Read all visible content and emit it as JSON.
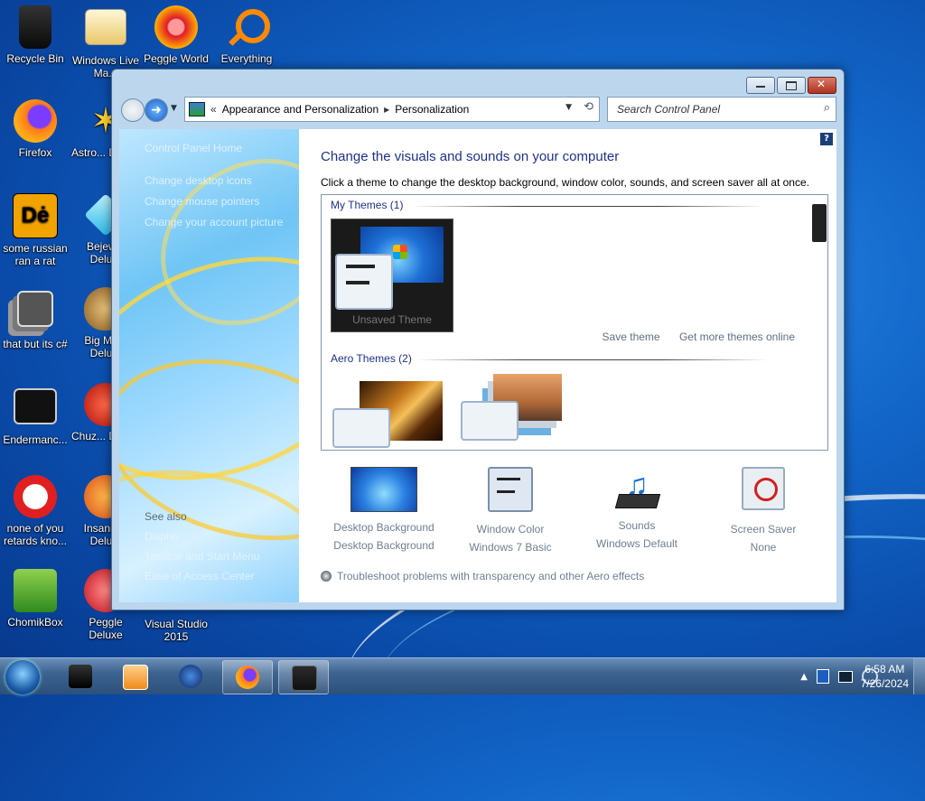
{
  "desktop": {
    "icons": [
      {
        "label": "Recycle Bin"
      },
      {
        "label": "Windows Live Ma..."
      },
      {
        "label": "Peggle World"
      },
      {
        "label": "Everything"
      },
      {
        "label": "Firefox"
      },
      {
        "label": "Astro... Delu..."
      },
      {
        "label": "some russian ran a rat"
      },
      {
        "label": "Bejew... Delu..."
      },
      {
        "label": "that but its c#"
      },
      {
        "label": "Big Mo... Delu..."
      },
      {
        "label": "Endermanc..."
      },
      {
        "label": "Chuz... Delu..."
      },
      {
        "label": "none of you retards kno..."
      },
      {
        "label": "Insaniq... Delu..."
      },
      {
        "label": "ChomikBox"
      },
      {
        "label": "Peggle Deluxe"
      },
      {
        "label": "Visual Studio 2015"
      }
    ]
  },
  "window": {
    "address": {
      "crumb_prefix": "«",
      "crumb1": "Appearance and Personalization",
      "crumb_sep": "▸",
      "crumb2": "Personalization"
    },
    "search": {
      "placeholder": "Search Control Panel"
    },
    "left_pane": {
      "home": "Control Panel Home",
      "links": [
        "Change desktop icons",
        "Change mouse pointers",
        "Change your account picture"
      ],
      "see_also": "See also",
      "see_also_links": [
        "Display",
        "Taskbar and Start Menu",
        "Ease of Access Center"
      ]
    },
    "content": {
      "title": "Change the visuals and sounds on your computer",
      "subtitle": "Click a theme to change the desktop background, window color, sounds, and screen saver all at once.",
      "my_themes_header": "My Themes (1)",
      "unsaved_theme_label": "Unsaved Theme",
      "save_theme": "Save theme",
      "get_more": "Get more themes online",
      "aero_header": "Aero Themes (2)",
      "bottom": [
        {
          "title": "Desktop Background",
          "value": "Desktop Background"
        },
        {
          "title": "Window Color",
          "value": "Windows 7 Basic"
        },
        {
          "title": "Sounds",
          "value": "Windows Default"
        },
        {
          "title": "Screen Saver",
          "value": "None"
        }
      ],
      "troubleshoot": "Troubleshoot problems with transparency and other Aero effects"
    }
  },
  "taskbar": {
    "clock_time": "6:58 AM",
    "clock_date": "7/26/2024"
  }
}
